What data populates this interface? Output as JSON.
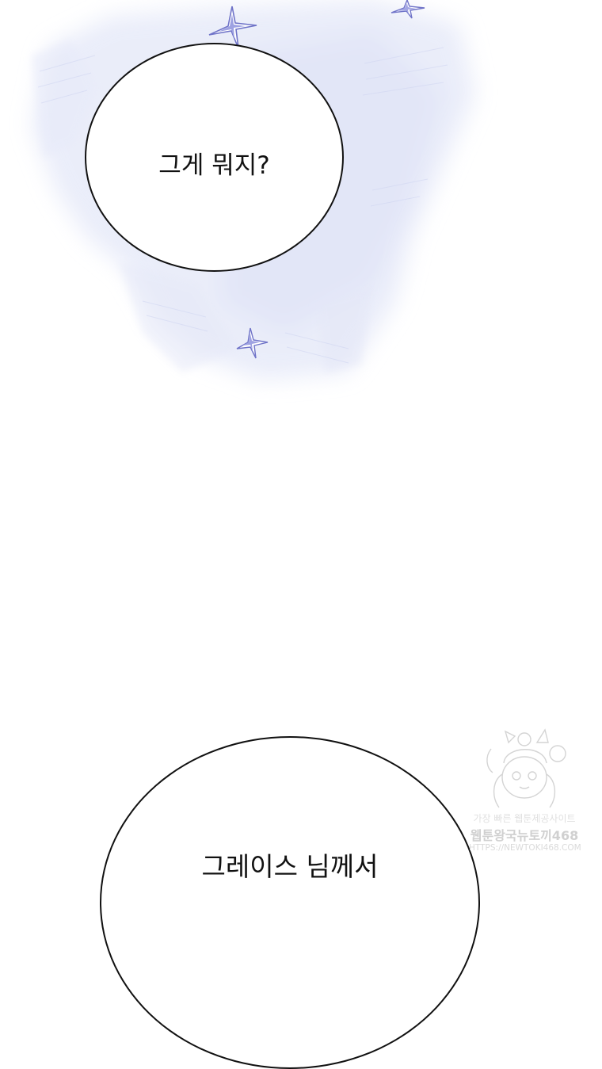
{
  "panel": {
    "bubble_top": {
      "text": "그게 뭐지?"
    },
    "bubble_bottom": {
      "text": "그레이스 님께서"
    }
  },
  "watermark": {
    "line1": "가장 빠른 웹툰제공사이트",
    "line2": "웹툰왕국뉴토끼468",
    "line3": "HTTPS://NEWTOKI468.COM"
  },
  "colors": {
    "background": "#ffffff",
    "haze": "#dfe3f7",
    "sparkle": "#6f73c8",
    "outline": "#111111"
  },
  "icons": [
    "sparkle-icon",
    "mascot-icon"
  ]
}
